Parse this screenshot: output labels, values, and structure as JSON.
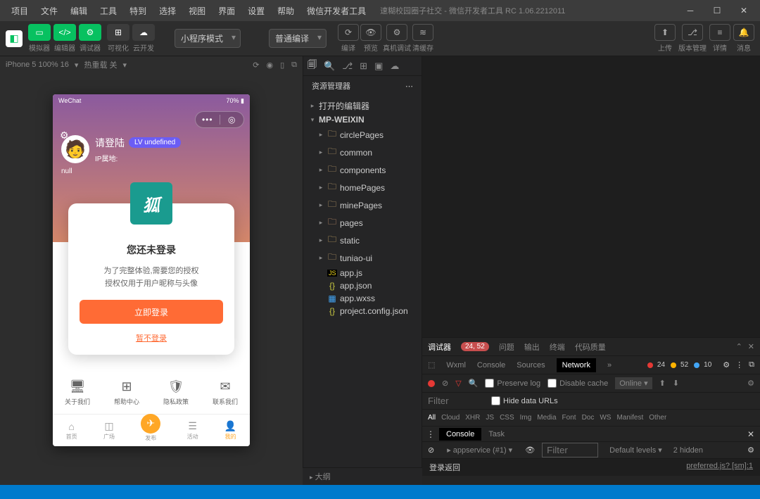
{
  "titlebar": {
    "menu": [
      "项目",
      "文件",
      "编辑",
      "工具",
      "特到",
      "选择",
      "视图",
      "界面",
      "设置",
      "帮助",
      "微信开发者工具"
    ],
    "title": "速糊校园圈子社交 - 微信开发者工具 RC 1.06.2212011"
  },
  "toolbar": {
    "groups": [
      {
        "icon": "▭",
        "label": "模拟器"
      },
      {
        "icon": "</>",
        "label": "编辑器"
      },
      {
        "icon": "⚙",
        "label": "调试器"
      }
    ],
    "darkGroups": [
      {
        "icon": "⊞",
        "label": "可视化"
      },
      {
        "icon": "☁",
        "label": "云开发"
      }
    ],
    "select1": "小程序模式",
    "select2": "普通编译",
    "actions": [
      {
        "icon": "⟳",
        "label": "编译"
      },
      {
        "icon": "👁",
        "label": "预览"
      },
      {
        "icon": "⚙",
        "label": "真机调试"
      },
      {
        "icon": "≋",
        "label": "清缓存"
      }
    ],
    "rightActions": [
      {
        "icon": "⬆",
        "label": "上传"
      },
      {
        "icon": "⎇",
        "label": "版本管理"
      },
      {
        "icon": "≡",
        "label": "详情"
      },
      {
        "icon": "🔔",
        "label": "消息"
      }
    ]
  },
  "simulator": {
    "device": "iPhone 5 100% 16",
    "reload": "热重载 关"
  },
  "phone": {
    "statusLeft": "WeChat",
    "statusRight": "70%",
    "userName": "请登陆",
    "lvBadge": "LV undefined",
    "ipLabel": "IP属地:",
    "nullText": "null",
    "modal": {
      "logo": "狐",
      "title": "您还未登录",
      "line1": "为了完整体验,需要您的授权",
      "line2": "授权仅用于用户昵称与头像",
      "btn": "立即登录",
      "link": "暂不登录"
    },
    "grid": [
      {
        "icon": "🖥",
        "label": "关于我们"
      },
      {
        "icon": "⊞",
        "label": "帮助中心"
      },
      {
        "icon": "🛡",
        "label": "隐私政策"
      },
      {
        "icon": "✉",
        "label": "联系我们"
      }
    ],
    "tabs": [
      {
        "icon": "⌂",
        "label": "首页"
      },
      {
        "icon": "◫",
        "label": "广场"
      },
      {
        "icon": "✈",
        "label": "发布",
        "center": true
      },
      {
        "icon": "☰",
        "label": "活动"
      },
      {
        "icon": "👤",
        "label": "我的",
        "current": true
      }
    ]
  },
  "explorer": {
    "title": "资源管理器",
    "openEditors": "打开的编辑器",
    "project": "MP-WEIXIN",
    "tree": [
      {
        "type": "folder",
        "name": "circlePages"
      },
      {
        "type": "folder",
        "name": "common"
      },
      {
        "type": "folder",
        "name": "components"
      },
      {
        "type": "folder",
        "name": "homePages"
      },
      {
        "type": "folder",
        "name": "minePages"
      },
      {
        "type": "folder",
        "name": "pages",
        "cls": "pages"
      },
      {
        "type": "folder",
        "name": "static",
        "cls": "static"
      },
      {
        "type": "folder",
        "name": "tuniao-ui"
      },
      {
        "type": "js",
        "name": "app.js"
      },
      {
        "type": "json",
        "name": "app.json"
      },
      {
        "type": "wxss",
        "name": "app.wxss"
      },
      {
        "type": "json",
        "name": "project.config.json"
      }
    ],
    "outline": "大纲"
  },
  "devtools": {
    "tabs": [
      "调试器",
      "问题",
      "输出",
      "终端",
      "代码质量"
    ],
    "badge": "24, 52",
    "subtabs": [
      "Wxml",
      "Console",
      "Sources",
      "Network"
    ],
    "status": [
      {
        "color": "#e53935",
        "count": "24"
      },
      {
        "color": "#ffb300",
        "count": "52"
      },
      {
        "color": "#42a5f5",
        "count": "10"
      }
    ],
    "preserveLog": "Preserve log",
    "disableCache": "Disable cache",
    "online": "Online",
    "filterPlaceholder": "Filter",
    "hideUrls": "Hide data URLs",
    "types": [
      "All",
      "Cloud",
      "XHR",
      "JS",
      "CSS",
      "Img",
      "Media",
      "Font",
      "Doc",
      "WS",
      "Manifest",
      "Other"
    ],
    "consoleTabs": [
      "Console",
      "Task"
    ],
    "context": "appservice (#1)",
    "cfilterPlaceholder": "Filter",
    "levels": "Default levels",
    "hidden": "2 hidden",
    "logMsg": "登录返回",
    "logSrc": "preferred.js? [sm]:1"
  }
}
